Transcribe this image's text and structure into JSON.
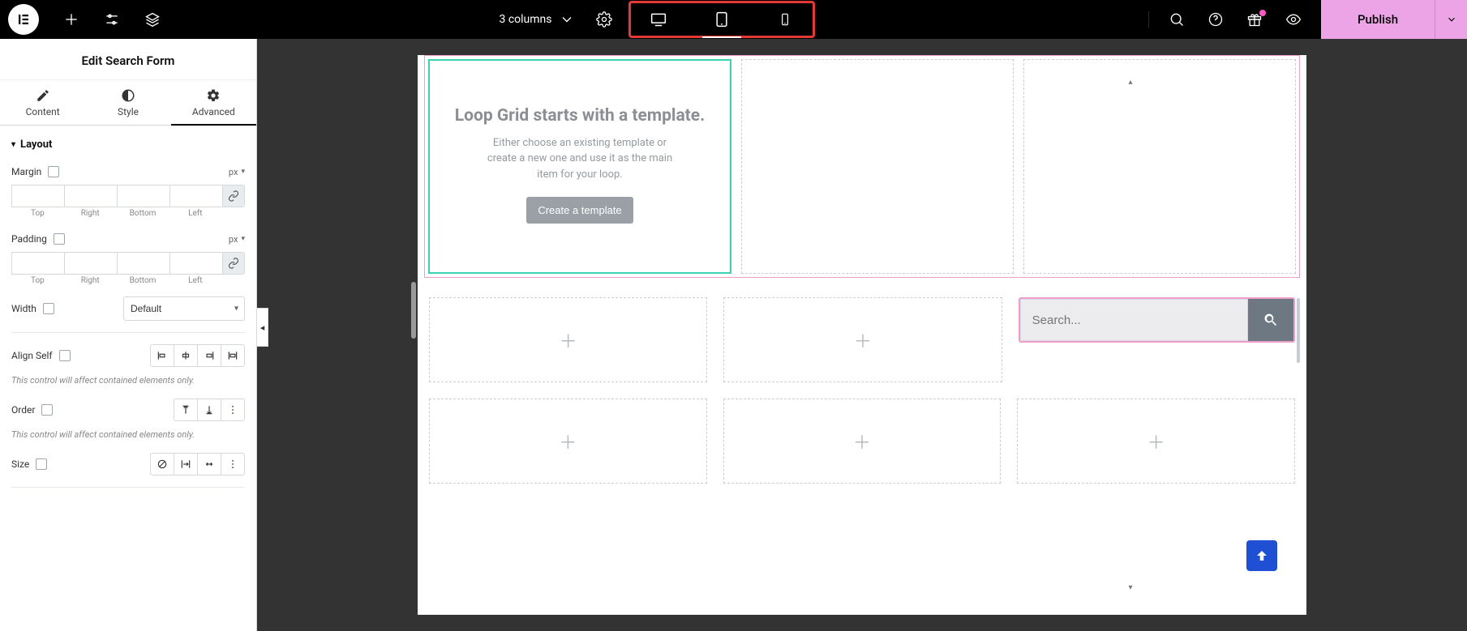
{
  "topbar": {
    "structure_label": "3 columns",
    "publish_label": "Publish"
  },
  "sidebar": {
    "title": "Edit Search Form",
    "tabs": {
      "content": "Content",
      "style": "Style",
      "advanced": "Advanced"
    },
    "section": "Layout",
    "margin_label": "Margin",
    "padding_label": "Padding",
    "unit_px": "px",
    "dims": {
      "top": "Top",
      "right": "Right",
      "bottom": "Bottom",
      "left": "Left"
    },
    "width_label": "Width",
    "width_value": "Default",
    "alignself_label": "Align Self",
    "note_text": "This control will affect contained elements only.",
    "order_label": "Order",
    "size_label": "Size"
  },
  "canvas": {
    "loop_title": "Loop Grid starts with a template.",
    "loop_desc": "Either choose an existing template or create a new one and use it as the main item for your loop.",
    "loop_btn": "Create a template",
    "search_placeholder": "Search..."
  }
}
